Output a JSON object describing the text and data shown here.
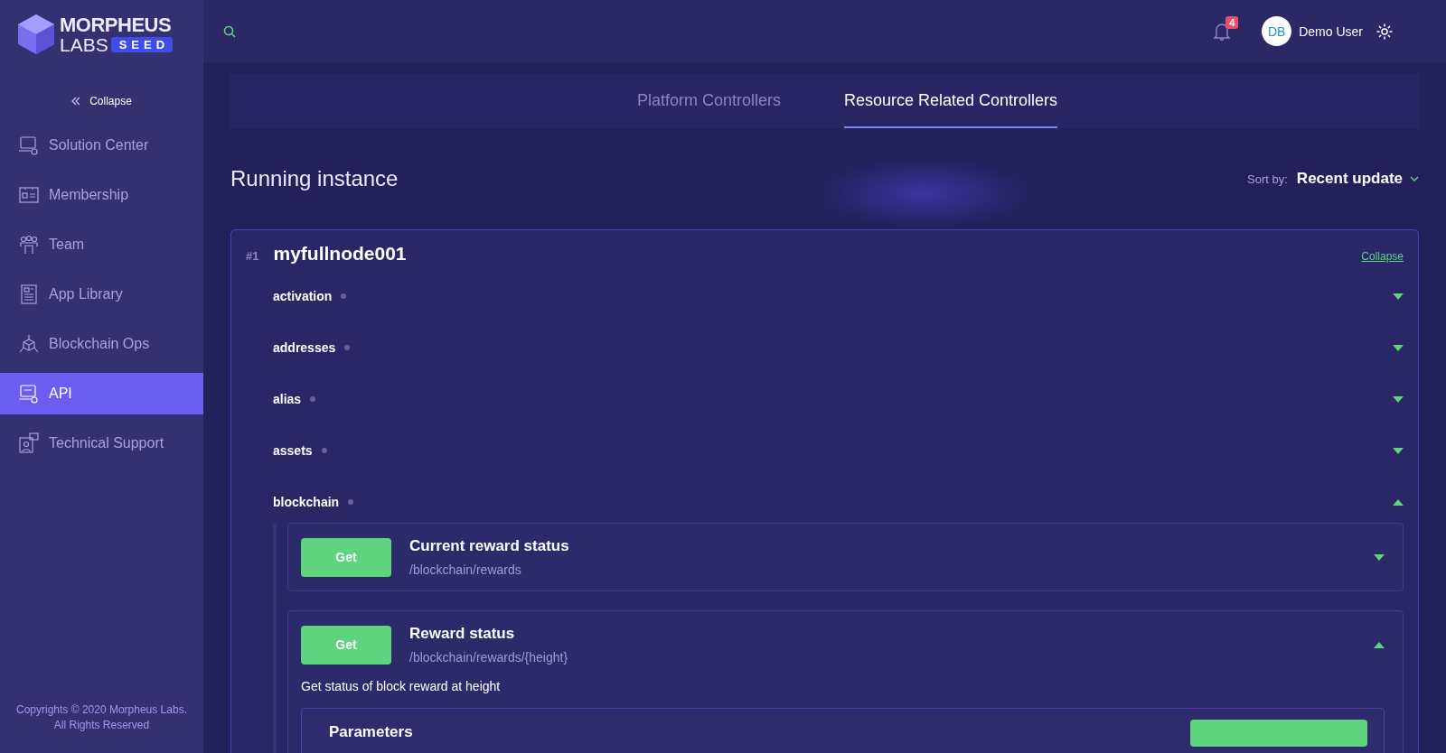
{
  "brand": {
    "name_top": "MORPHEUS",
    "name_bottom": "LABS",
    "badge": "SEED"
  },
  "sidebar": {
    "collapse_label": "Collapse",
    "items": [
      {
        "label": "Solution Center",
        "selected": false
      },
      {
        "label": "Membership",
        "selected": false
      },
      {
        "label": "Team",
        "selected": false
      },
      {
        "label": "App Library",
        "selected": false
      },
      {
        "label": "Blockchain Ops",
        "selected": false
      },
      {
        "label": "API",
        "selected": true
      },
      {
        "label": "Technical Support",
        "selected": false
      }
    ],
    "footer": [
      "Copyrights © 2020 Morpheus Labs.",
      "All Rights Reserved"
    ]
  },
  "topbar": {
    "notification_count": "4",
    "avatar_initials": "DB",
    "user_name": "Demo User"
  },
  "tabs": [
    {
      "label": "Platform Controllers",
      "selected": false
    },
    {
      "label": "Resource Related Controllers",
      "selected": true
    }
  ],
  "heading": "Running instance",
  "sort": {
    "label": "Sort by:",
    "value": "Recent update"
  },
  "instance": {
    "index": "#1",
    "name": "myfullnode001",
    "collapse_link": "Collapse",
    "groups": [
      {
        "name": "activation",
        "expanded": false
      },
      {
        "name": "addresses",
        "expanded": false
      },
      {
        "name": "alias",
        "expanded": false
      },
      {
        "name": "assets",
        "expanded": false
      },
      {
        "name": "blockchain",
        "expanded": true,
        "endpoints": [
          {
            "method": "Get",
            "title": "Current reward status",
            "path": "/blockchain/rewards",
            "expanded": false
          },
          {
            "method": "Get",
            "title": "Reward status",
            "path": "/blockchain/rewards/{height}",
            "expanded": true,
            "description": "Get status of block reward at height",
            "parameters_heading": "Parameters"
          }
        ]
      }
    ]
  }
}
